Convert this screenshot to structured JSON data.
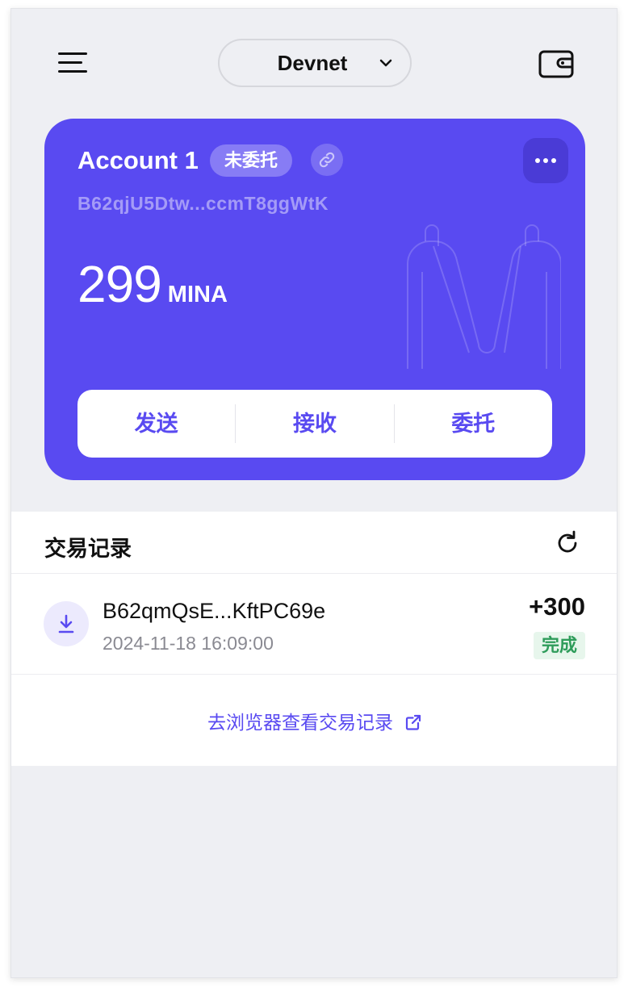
{
  "header": {
    "network_label": "Devnet",
    "menu_icon": "hamburger-menu-icon",
    "wallet_icon": "wallet-icon"
  },
  "account": {
    "name": "Account 1",
    "delegation_badge": "未委托",
    "address": "B62qjU5Dtw...ccmT8ggWtK",
    "balance": "299",
    "unit": "MINA",
    "colors": {
      "card": "#594af1",
      "accent": "#594af1"
    }
  },
  "actions": {
    "send": "发送",
    "receive": "接收",
    "delegate": "委托"
  },
  "transactions": {
    "title": "交易记录",
    "items": [
      {
        "address": "B62qmQsE...KftPC69e",
        "time": "2024-11-18 16:09:00",
        "amount": "+300",
        "status": "完成",
        "icon": "download-icon"
      }
    ],
    "explorer_link": "去浏览器查看交易记录"
  }
}
